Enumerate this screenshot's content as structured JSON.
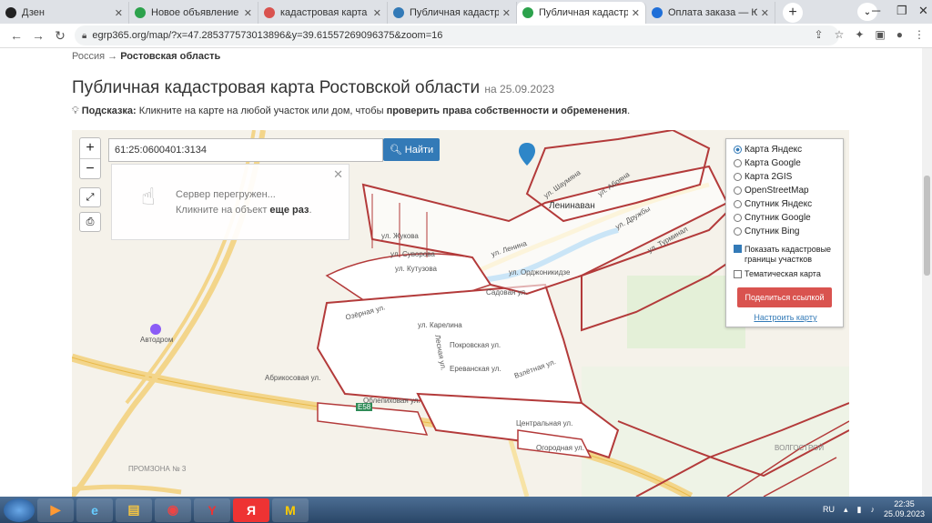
{
  "tabs": [
    {
      "title": "Дзен",
      "color": "#222222",
      "active": false
    },
    {
      "title": "Новое объявление — ...",
      "color": "#2ca24c",
      "active": false
    },
    {
      "title": "кадастровая карта рос...",
      "color": "#d9534f",
      "active": false
    },
    {
      "title": "Публичная кадастрова...",
      "color": "#337ab7",
      "active": false
    },
    {
      "title": "Публичная кадастров...",
      "color": "#2ca24c",
      "active": true
    },
    {
      "title": "Оплата заказа — ЮКа...",
      "color": "#1f6fd8",
      "active": false
    }
  ],
  "address": {
    "url": "egrp365.org/map/?x=47.285377573013896&y=39.61557269096375&zoom=16"
  },
  "breadcrumb": {
    "root": "Россия",
    "arrow": "→",
    "current": "Ростовская область"
  },
  "page": {
    "title": "Публичная кадастровая карта Ростовской области",
    "date": "на 25.09.2023",
    "hint_label": "Подсказка:",
    "hint_text": "Кликните на карте на любой участок или дом, чтобы",
    "hint_bold": "проверить права собственности и обременения",
    "hint_end": "."
  },
  "map": {
    "zoom_in": "+",
    "zoom_out": "−",
    "search_value": "61:25:0600401:3134",
    "find_label": "Найти",
    "popup": {
      "line1": "Сервер перегружен...",
      "line2": "Кликните на объект",
      "line2_bold": "еще раз",
      "line2_end": "."
    },
    "layers": [
      {
        "label": "Карта Яндекс",
        "selected": true
      },
      {
        "label": "Карта Google",
        "selected": false
      },
      {
        "label": "Карта 2GIS",
        "selected": false
      },
      {
        "label": "OpenStreetMap",
        "selected": false
      },
      {
        "label": "Спутник Яндекс",
        "selected": false
      },
      {
        "label": "Спутник Google",
        "selected": false
      },
      {
        "label": "Спутник Bing",
        "selected": false
      }
    ],
    "cadastral_checkbox": {
      "label": "Показать кадастровые границы участков",
      "checked": true
    },
    "thematic_checkbox": {
      "label": "Тематическая карта",
      "checked": false
    },
    "share_label": "Поделиться ссылкой",
    "setup_label": "Настроить карту",
    "labels": {
      "town": "Ленинавaн",
      "autodrome": "Автодром",
      "zhukova": "ул. Жукова",
      "suvorova": "ул. Суворова",
      "kutuzova": "ул. Кутузова",
      "lenina": "ул. Ленина",
      "ordzhonikidze": "ул. Орджоникидзе",
      "sadovaya": "Садовая ул.",
      "shaumyana": "ул. Шаумяна",
      "aboyana": "ул. Абояна",
      "druzhby": "ул. Дружбы",
      "turminal": "ул. Турминал",
      "ozernaya": "Озёрная ул.",
      "karelina": "ул. Карелина",
      "pokrovskaya": "Покровская ул.",
      "lesnaya": "Лесная ул.",
      "erevanskaya": "Ереванская ул.",
      "vzletnaya": "Взлётная ул.",
      "oblepikhovaya": "Облепиховая ул.",
      "abrikosovaya": "Абрикосовая ул.",
      "tsentralnaya": "Центральная ул.",
      "ogorodnaya": "Огородная ул.",
      "e58": "E58",
      "promzona": "ПРОМЗОНА № 3",
      "volgostroy": "ВОЛГОСТРОЙ"
    }
  },
  "taskbar": {
    "lang": "RU",
    "time": "22:35",
    "date": "25.09.2023"
  }
}
